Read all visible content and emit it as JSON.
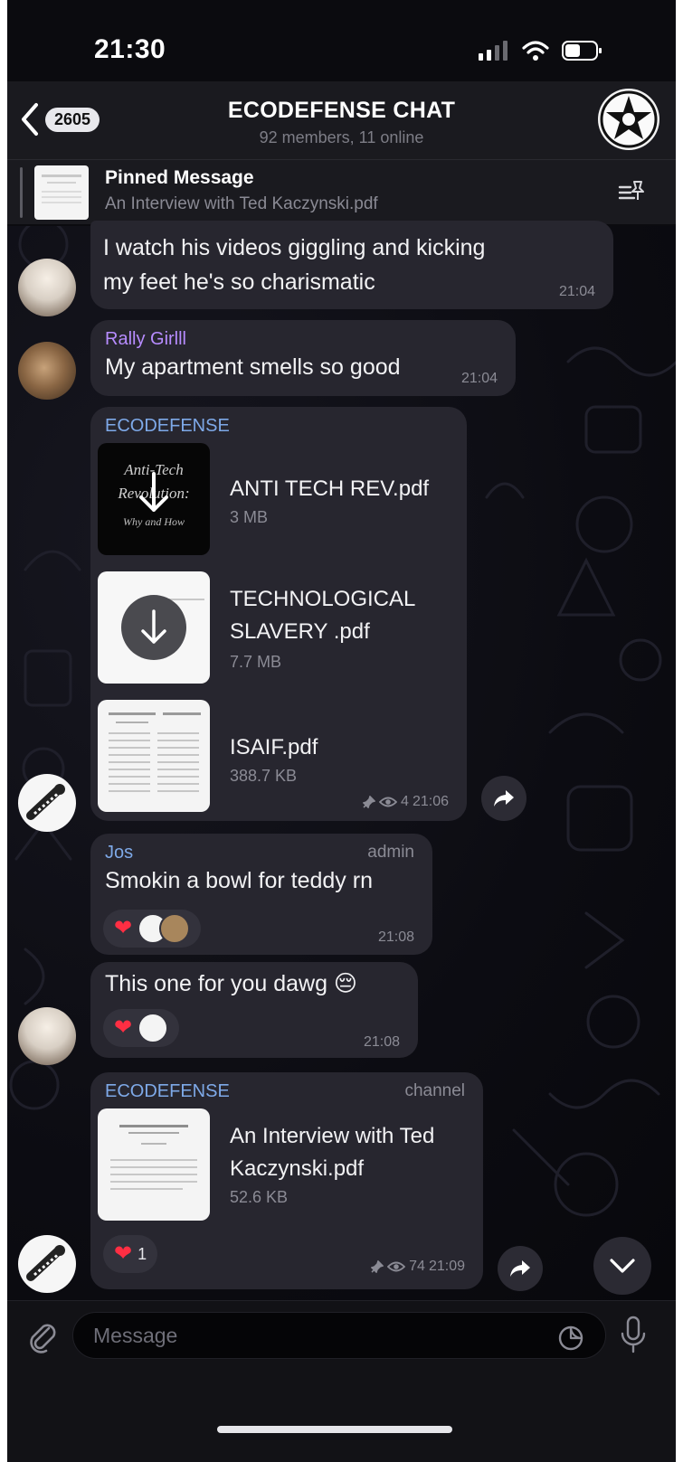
{
  "status_bar": {
    "time": "21:30"
  },
  "header": {
    "back_count": "2605",
    "title": "ECODEFENSE CHAT",
    "subtitle": "92 members, 11 online"
  },
  "pinned": {
    "title": "Pinned Message",
    "text": "An Interview with Ted Kaczynski.pdf"
  },
  "messages": [
    {
      "lines": [
        "I watch his videos giggling and kicking",
        "my feet he's so charismatic"
      ],
      "time": "21:04"
    },
    {
      "sender": "Rally Girlll",
      "text": "My apartment smells so good",
      "time": "21:04"
    },
    {
      "sender": "ECODEFENSE",
      "files": [
        {
          "thumb_lines": [
            "Anti-Tech",
            "Revolution:",
            "Why and How"
          ],
          "name_lines": [
            "ANTI TECH REV.pdf"
          ],
          "size": "3 MB"
        },
        {
          "name_lines": [
            "TECHNOLOGICAL",
            "SLAVERY .pdf"
          ],
          "size": "7.7 MB"
        },
        {
          "name_lines": [
            "ISAIF.pdf"
          ],
          "size": "388.7 KB"
        }
      ],
      "views": "4",
      "time": "21:06"
    },
    {
      "sender": "Jos",
      "tag": "admin",
      "text": "Smokin a bowl for teddy rn",
      "time": "21:08"
    },
    {
      "text": "This one for you dawg 😔",
      "time": "21:08"
    },
    {
      "sender": "ECODEFENSE",
      "tag": "channel",
      "file": {
        "name_lines": [
          "An Interview with Ted",
          "Kaczynski.pdf"
        ],
        "size": "52.6 KB"
      },
      "reaction_count": "1",
      "views": "74",
      "time": "21:09"
    }
  ],
  "input": {
    "placeholder": "Message"
  },
  "colors": {
    "background": "#0b0b0f",
    "bubble": "#27262f",
    "sender_purple": "#b78cff",
    "sender_blue": "#7ea9e8",
    "heart": "#ff2e43"
  },
  "icons": [
    "back-chevron-icon",
    "signal-icon",
    "wifi-icon",
    "battery-icon",
    "pin-list-icon",
    "download-icon",
    "pin-icon",
    "eye-icon",
    "share-icon",
    "chevron-down-icon",
    "paperclip-icon",
    "sticker-icon",
    "microphone-icon"
  ]
}
